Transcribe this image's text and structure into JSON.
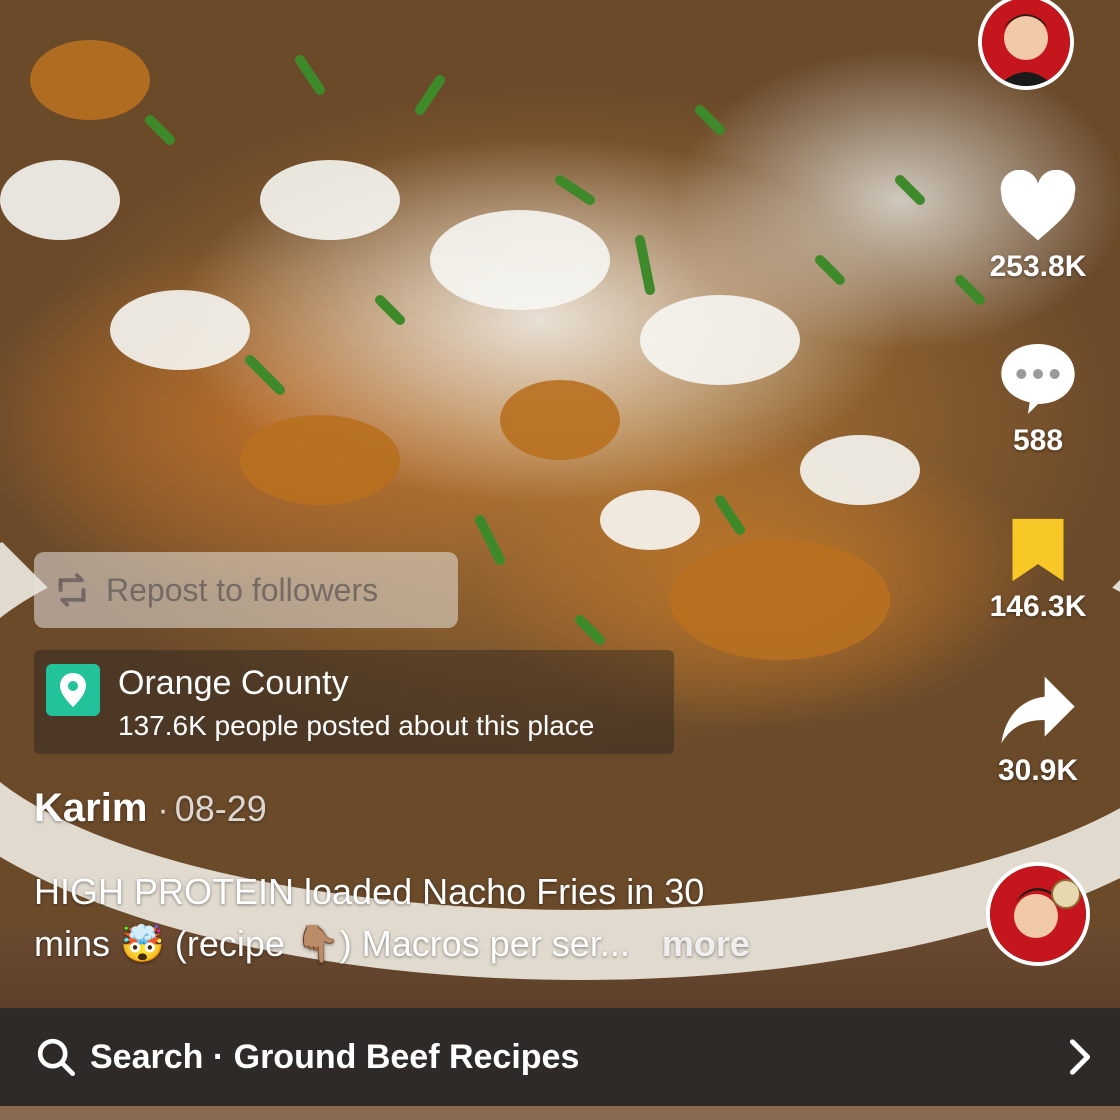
{
  "profile": {
    "top_avatar_icon": "creator-avatar-icon",
    "sound_avatar_icon": "sound-disc-icon"
  },
  "actions": {
    "like": {
      "icon": "heart-icon",
      "count": "253.8K"
    },
    "comment": {
      "icon": "comment-bubble-icon",
      "count": "588"
    },
    "bookmark": {
      "icon": "bookmark-icon",
      "count": "146.3K",
      "color": "#F8C826"
    },
    "share": {
      "icon": "share-arrow-icon",
      "count": "30.9K"
    }
  },
  "repost": {
    "icon": "repost-icon",
    "label": "Repost to followers"
  },
  "location": {
    "icon": "location-pin-icon",
    "name": "Orange County",
    "subtitle": "137.6K people posted about this place",
    "accent": "#22C29A"
  },
  "post": {
    "author": "Karim",
    "separator": "·",
    "date": "08-29",
    "caption_line1": "HIGH PROTEIN loaded Nacho Fries in 30",
    "caption_line2_a": "mins",
    "caption_emoji1": "🤯",
    "caption_line2_b": "(recipe",
    "caption_emoji2": "👇🏽",
    "caption_line2_c": ")  Macros per ser...",
    "more_label": "more"
  },
  "search": {
    "icon": "search-icon",
    "label": "Search · Ground Beef Recipes",
    "chevron": "chevron-right-icon"
  }
}
